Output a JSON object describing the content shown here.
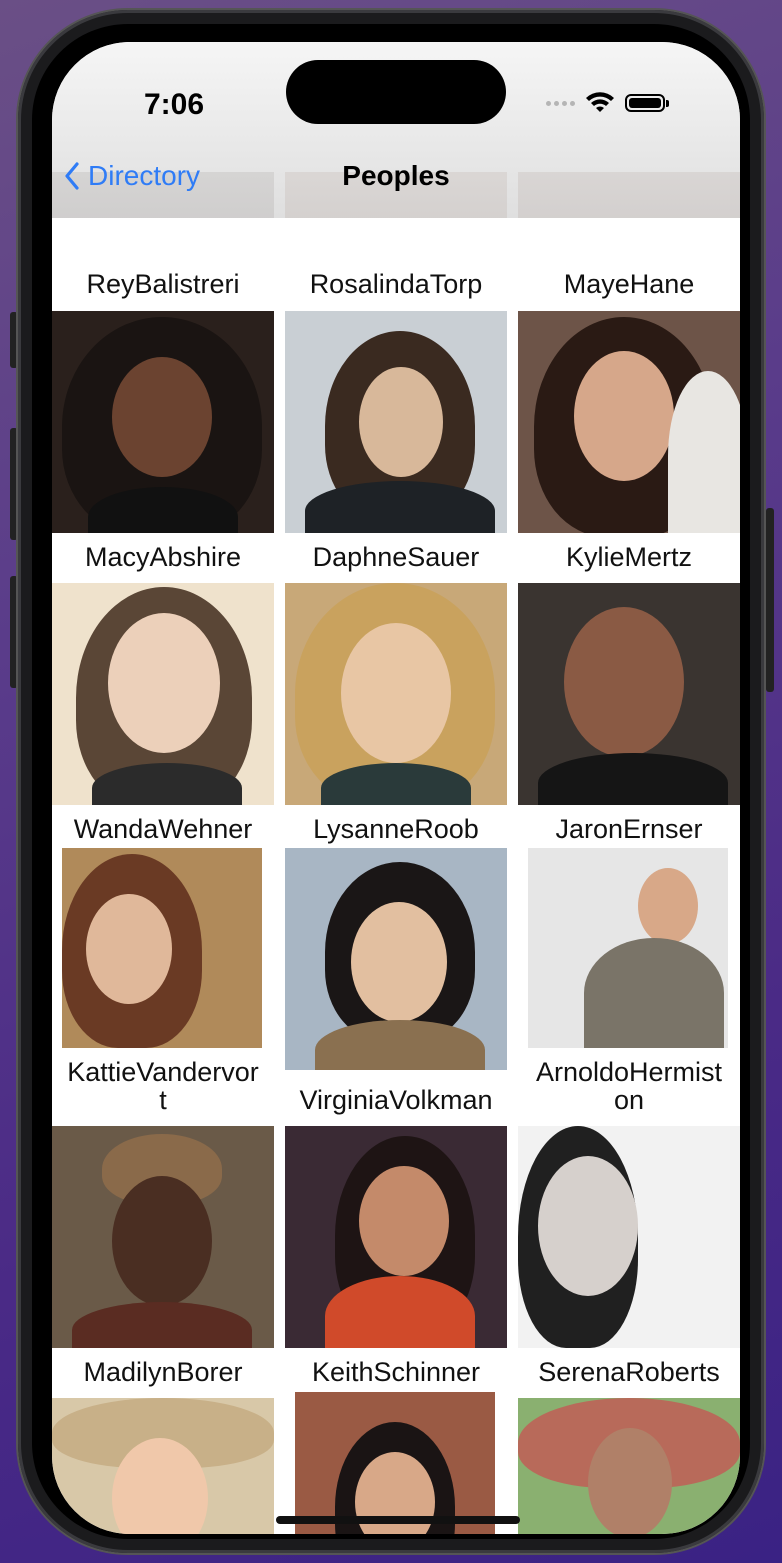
{
  "status_bar": {
    "time": "7:06"
  },
  "nav": {
    "back_label": "Directory",
    "title": "Peoples"
  },
  "people": [
    {
      "name": "ReyBalistreri",
      "line2": ""
    },
    {
      "name": "RosalindaTorp",
      "line2": ""
    },
    {
      "name": "MayeHane",
      "line2": ""
    },
    {
      "name": "MacyAbshire",
      "line2": ""
    },
    {
      "name": "DaphneSauer",
      "line2": ""
    },
    {
      "name": "KylieMertz",
      "line2": ""
    },
    {
      "name": "WandaWehner",
      "line2": ""
    },
    {
      "name": "LysanneRoob",
      "line2": ""
    },
    {
      "name": "JaronErnser",
      "line2": ""
    },
    {
      "name": "KattieVandervor",
      "line2": "t"
    },
    {
      "name": "VirginiaVolkman",
      "line2": ""
    },
    {
      "name": "ArnoldoHermist",
      "line2": "on"
    },
    {
      "name": "MadilynBorer",
      "line2": ""
    },
    {
      "name": "KeithSchinner",
      "line2": ""
    },
    {
      "name": "SerenaRoberts",
      "line2": ""
    }
  ]
}
